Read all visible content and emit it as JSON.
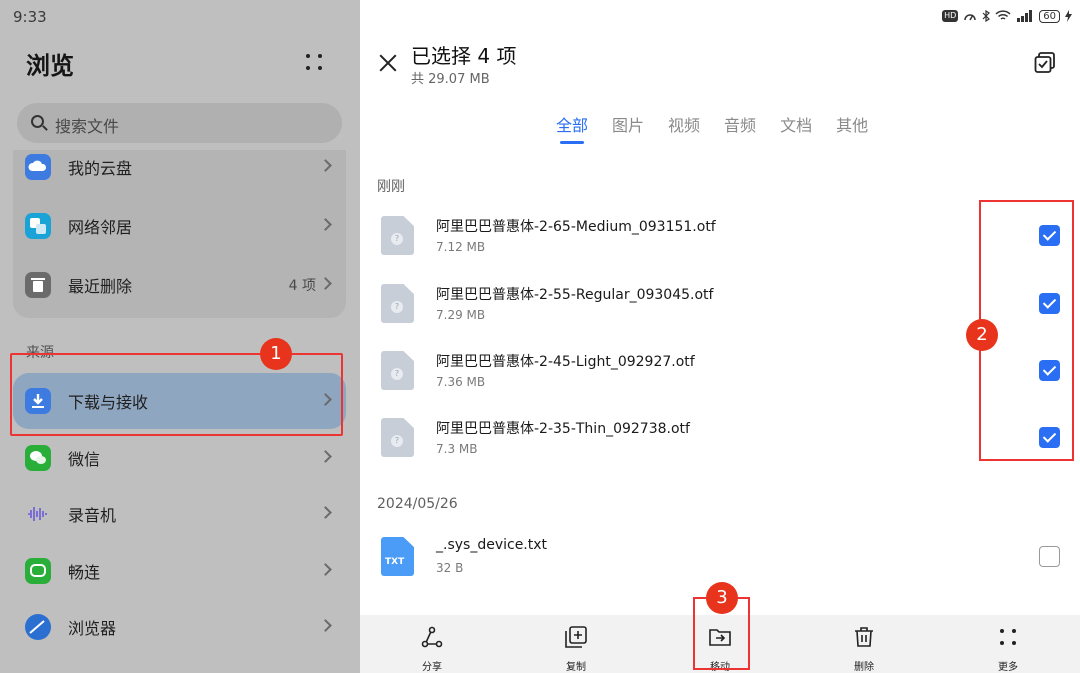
{
  "left": {
    "status_time": "9:33",
    "title": "浏览",
    "search_placeholder": "搜索文件",
    "top_items": [
      {
        "label": "我的云盘"
      },
      {
        "label": "网络邻居"
      },
      {
        "label": "最近删除",
        "count": "4 项"
      }
    ],
    "section_source": "来源",
    "source_items": [
      {
        "label": "下载与接收"
      },
      {
        "label": "微信"
      },
      {
        "label": "录音机"
      },
      {
        "label": "畅连"
      },
      {
        "label": "浏览器"
      }
    ]
  },
  "annotations": {
    "badge1": "1",
    "badge2": "2",
    "badge3": "3"
  },
  "right": {
    "status": {
      "hd": "HD",
      "battery": "60"
    },
    "selection_title": "已选择 4 项",
    "selection_size": "共 29.07 MB",
    "tabs": [
      "全部",
      "图片",
      "视频",
      "音频",
      "文档",
      "其他"
    ],
    "groups": [
      {
        "label": "刚刚",
        "files": [
          {
            "name": "阿里巴巴普惠体-2-65-Medium_093151.otf",
            "size": "7.12 MB",
            "checked": true
          },
          {
            "name": "阿里巴巴普惠体-2-55-Regular_093045.otf",
            "size": "7.29 MB",
            "checked": true
          },
          {
            "name": "阿里巴巴普惠体-2-45-Light_092927.otf",
            "size": "7.36 MB",
            "checked": true
          },
          {
            "name": "阿里巴巴普惠体-2-35-Thin_092738.otf",
            "size": "7.3 MB",
            "checked": true
          }
        ]
      },
      {
        "label": "2024/05/26",
        "files": [
          {
            "name": "_.sys_device.txt",
            "size": "32 B",
            "checked": false,
            "type_label": "TXT"
          }
        ]
      }
    ],
    "toolbar": {
      "share": "分享",
      "copy": "复制",
      "move": "移动",
      "delete": "删除",
      "more": "更多"
    }
  },
  "colors": {
    "accent": "#2a6ff3",
    "annotation": "#e8341c"
  }
}
